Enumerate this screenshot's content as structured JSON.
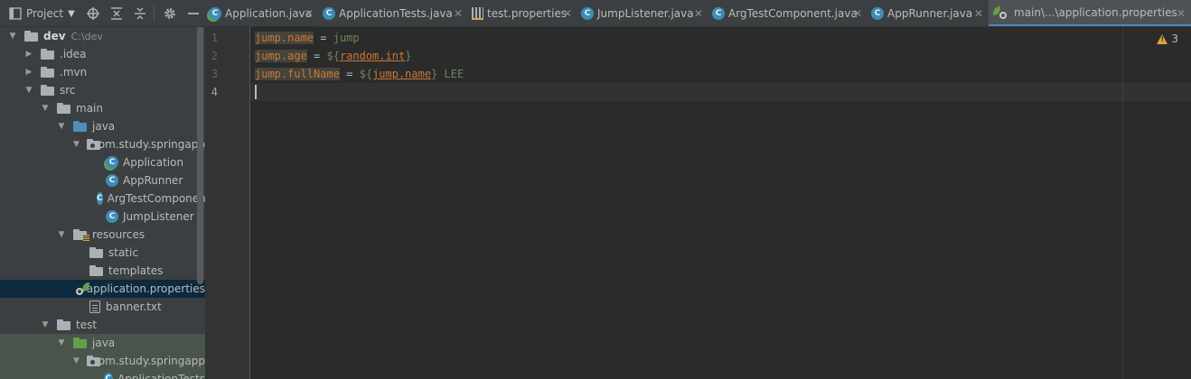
{
  "project_panel": {
    "title": "Project",
    "tree": [
      {
        "label": "dev",
        "hint": "C:\\dev",
        "indent": 0,
        "arrow": "open",
        "icon": "folder-gray",
        "bold": true
      },
      {
        "label": ".idea",
        "indent": 1,
        "arrow": "closed",
        "icon": "folder-gray"
      },
      {
        "label": ".mvn",
        "indent": 1,
        "arrow": "closed",
        "icon": "folder-gray"
      },
      {
        "label": "src",
        "indent": 1,
        "arrow": "open",
        "icon": "folder-gray"
      },
      {
        "label": "main",
        "indent": 2,
        "arrow": "open",
        "icon": "folder-gray"
      },
      {
        "label": "java",
        "indent": 3,
        "arrow": "open",
        "icon": "folder-blue"
      },
      {
        "label": "com.study.springapp",
        "indent": 4,
        "arrow": "open",
        "icon": "package"
      },
      {
        "label": "Application",
        "indent": 5,
        "arrow": "none",
        "icon": "spring-class"
      },
      {
        "label": "AppRunner",
        "indent": 5,
        "arrow": "none",
        "icon": "class"
      },
      {
        "label": "ArgTestComponent",
        "indent": 5,
        "arrow": "none",
        "icon": "class"
      },
      {
        "label": "JumpListener",
        "indent": 5,
        "arrow": "none",
        "icon": "class"
      },
      {
        "label": "resources",
        "indent": 3,
        "arrow": "open",
        "icon": "folder-resources"
      },
      {
        "label": "static",
        "indent": 4,
        "arrow": "none",
        "icon": "folder-gray"
      },
      {
        "label": "templates",
        "indent": 4,
        "arrow": "none",
        "icon": "folder-gray"
      },
      {
        "label": "application.properties",
        "indent": 4,
        "arrow": "none",
        "icon": "spring-properties",
        "selected": true
      },
      {
        "label": "banner.txt",
        "indent": 4,
        "arrow": "none",
        "icon": "text-file"
      },
      {
        "label": "test",
        "indent": 2,
        "arrow": "open",
        "icon": "folder-gray"
      },
      {
        "label": "java",
        "indent": 3,
        "arrow": "open",
        "icon": "folder-green",
        "test": true
      },
      {
        "label": "com.study.springapp",
        "indent": 4,
        "arrow": "open",
        "icon": "package",
        "test": true
      },
      {
        "label": "ApplicationTests",
        "indent": 5,
        "arrow": "none",
        "icon": "class",
        "test": true
      }
    ]
  },
  "tabs": [
    {
      "label": "Application.java",
      "icon": "spring-class-icon",
      "active": false
    },
    {
      "label": "ApplicationTests.java",
      "icon": "class-icon",
      "active": false
    },
    {
      "label": "test.properties",
      "icon": "properties-icon",
      "active": false
    },
    {
      "label": "JumpListener.java",
      "icon": "class-icon",
      "active": false
    },
    {
      "label": "ArgTestComponent.java",
      "icon": "class-icon",
      "active": false
    },
    {
      "label": "AppRunner.java",
      "icon": "class-icon",
      "active": false
    },
    {
      "label": "main\\...\\application.properties",
      "icon": "spring-properties-icon",
      "active": true
    }
  ],
  "editor": {
    "line_numbers": [
      "1",
      "2",
      "3",
      "4"
    ],
    "current_line": 4,
    "lines": [
      [
        {
          "t": "jump.name",
          "c": "key"
        },
        {
          "t": " = ",
          "c": "eq"
        },
        {
          "t": "jump",
          "c": "val"
        }
      ],
      [
        {
          "t": "jump.age",
          "c": "key"
        },
        {
          "t": " = ",
          "c": "eq"
        },
        {
          "t": "${",
          "c": "val"
        },
        {
          "t": "random.int",
          "c": "ref"
        },
        {
          "t": "}",
          "c": "val"
        }
      ],
      [
        {
          "t": "jump.fullName",
          "c": "key"
        },
        {
          "t": " = ",
          "c": "eq"
        },
        {
          "t": "${",
          "c": "val"
        },
        {
          "t": "jump.name",
          "c": "ref"
        },
        {
          "t": "} LEE",
          "c": "val"
        }
      ],
      []
    ],
    "warnings_count": "3"
  },
  "colors": {
    "accent": "#4a88c7",
    "selected_row": "#0d293e",
    "test_row": "#49544a",
    "property_key": "#cc7832",
    "property_value": "#6a8759",
    "warning": "#e2a53a"
  }
}
